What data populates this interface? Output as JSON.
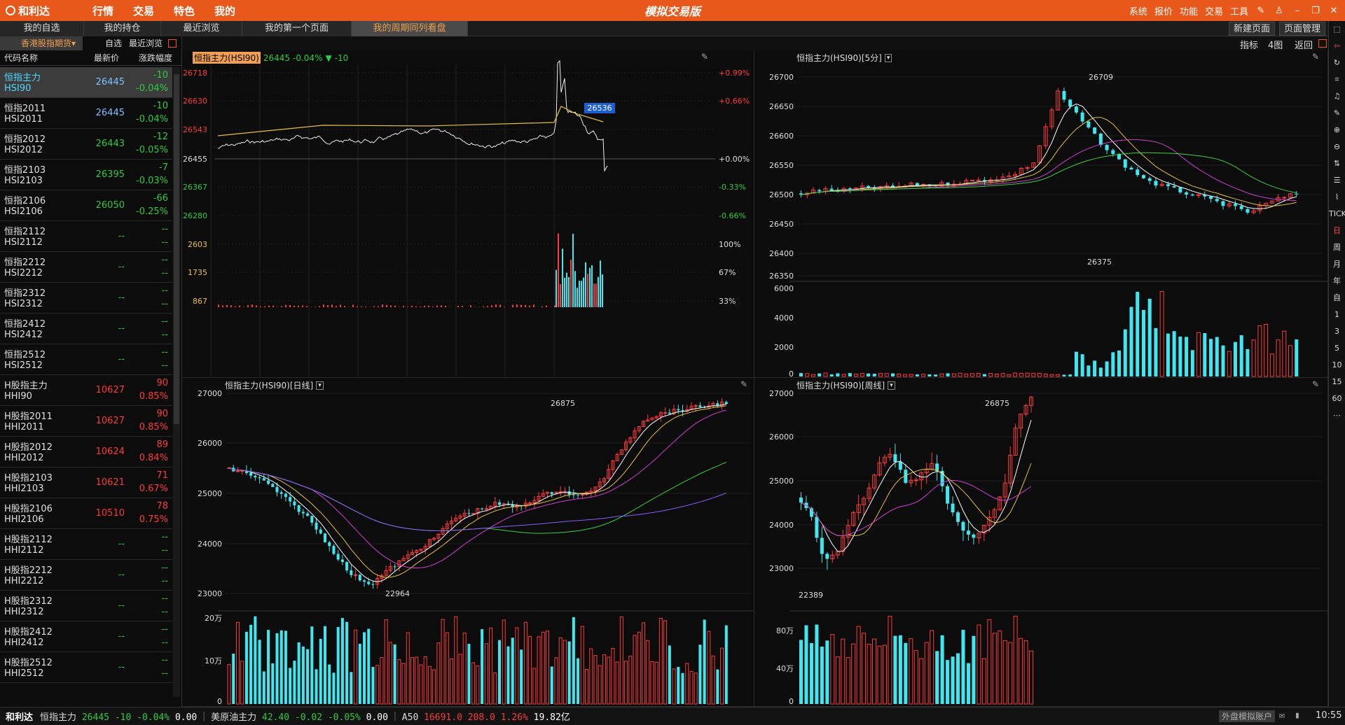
{
  "app": {
    "logo": "和利达",
    "menu": [
      "行情",
      "交易",
      "特色",
      "我的"
    ],
    "center_title": "模拟交易版",
    "right_menu": [
      "系统",
      "报价",
      "功能",
      "交易",
      "工具"
    ]
  },
  "tabs": [
    "我的自选",
    "我的持仓",
    "最近浏览",
    "我的第一个页面",
    "我的周期同列看盘"
  ],
  "tab_buttons": {
    "new_page": "新建页面",
    "page_manage": "页面管理"
  },
  "subbar": {
    "indicator": "指标",
    "four_charts": "4图",
    "back": "返回"
  },
  "left": {
    "category": "香港股指期货",
    "filter1": "自选",
    "filter2": "最近浏览",
    "headers": {
      "name": "代码名称",
      "price": "最新价",
      "change": "涨跌幅度"
    },
    "rows": [
      {
        "name": "恒指主力",
        "code": "HSI90",
        "price": "26445",
        "chg": "-10",
        "pct": "-0.04%",
        "dir": "dn"
      },
      {
        "name": "恒指2011",
        "code": "HSI2011",
        "price": "26445",
        "chg": "-10",
        "pct": "-0.04%",
        "dir": "dn"
      },
      {
        "name": "恒指2012",
        "code": "HSI2012",
        "price": "26443",
        "chg": "-12",
        "pct": "-0.05%",
        "dir": "dn"
      },
      {
        "name": "恒指2103",
        "code": "HSI2103",
        "price": "26395",
        "chg": "-7",
        "pct": "-0.03%",
        "dir": "dn"
      },
      {
        "name": "恒指2106",
        "code": "HSI2106",
        "price": "26050",
        "chg": "-66",
        "pct": "-0.25%",
        "dir": "dn"
      },
      {
        "name": "恒指2112",
        "code": "HSI2112",
        "price": "--",
        "chg": "--",
        "pct": "--",
        "dir": "gy"
      },
      {
        "name": "恒指2212",
        "code": "HSI2212",
        "price": "--",
        "chg": "--",
        "pct": "--",
        "dir": "gy"
      },
      {
        "name": "恒指2312",
        "code": "HSI2312",
        "price": "--",
        "chg": "--",
        "pct": "--",
        "dir": "gy"
      },
      {
        "name": "恒指2412",
        "code": "HSI2412",
        "price": "--",
        "chg": "--",
        "pct": "--",
        "dir": "gy"
      },
      {
        "name": "恒指2512",
        "code": "HSI2512",
        "price": "--",
        "chg": "--",
        "pct": "--",
        "dir": "gy"
      },
      {
        "name": "H股指主力",
        "code": "HHI90",
        "price": "10627",
        "chg": "90",
        "pct": "0.85%",
        "dir": "up"
      },
      {
        "name": "H股指2011",
        "code": "HHI2011",
        "price": "10627",
        "chg": "90",
        "pct": "0.85%",
        "dir": "up"
      },
      {
        "name": "H股指2012",
        "code": "HHI2012",
        "price": "10624",
        "chg": "89",
        "pct": "0.84%",
        "dir": "up"
      },
      {
        "name": "H股指2103",
        "code": "HHI2103",
        "price": "10621",
        "chg": "71",
        "pct": "0.67%",
        "dir": "up"
      },
      {
        "name": "H股指2106",
        "code": "HHI2106",
        "price": "10510",
        "chg": "78",
        "pct": "0.75%",
        "dir": "up"
      },
      {
        "name": "H股指2112",
        "code": "HHI2112",
        "price": "--",
        "chg": "--",
        "pct": "--",
        "dir": "gy"
      },
      {
        "name": "H股指2212",
        "code": "HHI2212",
        "price": "--",
        "chg": "--",
        "pct": "--",
        "dir": "gy"
      },
      {
        "name": "H股指2312",
        "code": "HHI2312",
        "price": "--",
        "chg": "--",
        "pct": "--",
        "dir": "gy"
      },
      {
        "name": "H股指2412",
        "code": "HHI2412",
        "price": "--",
        "chg": "--",
        "pct": "--",
        "dir": "gy"
      },
      {
        "name": "H股指2512",
        "code": "HHI2512",
        "price": "--",
        "chg": "--",
        "pct": "--",
        "dir": "gy"
      }
    ]
  },
  "rightbar": [
    "TICK",
    "日",
    "周",
    "月",
    "年",
    "自",
    "1",
    "3",
    "5",
    "10",
    "15",
    "60",
    "⋯"
  ],
  "charts": {
    "intraday": {
      "title": "恒指主力(HSI90)",
      "price": "26445",
      "pct": "-0.04%",
      "chg": "-10",
      "left_ticks": [
        "26718",
        "26630",
        "26543",
        "26455",
        "26367",
        "26280",
        "2603",
        "1735",
        "867"
      ],
      "right_ticks": [
        "+0.99%",
        "+0.66%",
        "+0.00%",
        "-0.33%",
        "-0.66%",
        "100%",
        "67%",
        "33%"
      ],
      "current_tag": "26536"
    },
    "min5": {
      "title": "恒指主力(HSI90)[5分]",
      "yticks": [
        "26700",
        "26650",
        "26600",
        "26550",
        "26500",
        "26450",
        "26400",
        "26350"
      ],
      "vticks": [
        "6000",
        "4000",
        "2000",
        "0"
      ],
      "high_label": "26709",
      "low_label": "26375"
    },
    "daily": {
      "title": "恒指主力(HSI90)[日线]",
      "yticks": [
        "27000",
        "26000",
        "25000",
        "24000",
        "23000"
      ],
      "vticks": [
        "20万",
        "10万",
        "0"
      ],
      "high_label": "26875",
      "low_label": "22964"
    },
    "weekly": {
      "title": "恒指主力(HSI90)[周线]",
      "yticks": [
        "27000",
        "26000",
        "25000",
        "24000",
        "23000"
      ],
      "vticks": [
        "80万",
        "40万",
        "0"
      ],
      "high_label": "26875",
      "low_label": "22389"
    }
  },
  "colors": {
    "up": "#ff3b3b",
    "down": "#3fe8f0",
    "accent": "#e8581a"
  },
  "status": {
    "brand": "和利达",
    "items": [
      {
        "name": "恒指主力",
        "price": "26445",
        "chg": "-10",
        "pct": "-0.04%",
        "vol": "0.00",
        "dir": "dn"
      },
      {
        "name": "美原油主力",
        "price": "42.40",
        "chg": "-0.02",
        "pct": "-0.05%",
        "vol": "0.00",
        "dir": "dn"
      },
      {
        "name": "A50",
        "price": "16691.0",
        "chg": "208.0",
        "pct": "1.26%",
        "vol": "19.82亿",
        "dir": "up"
      }
    ],
    "account": "外盘模拟账户",
    "time": "10:55"
  }
}
